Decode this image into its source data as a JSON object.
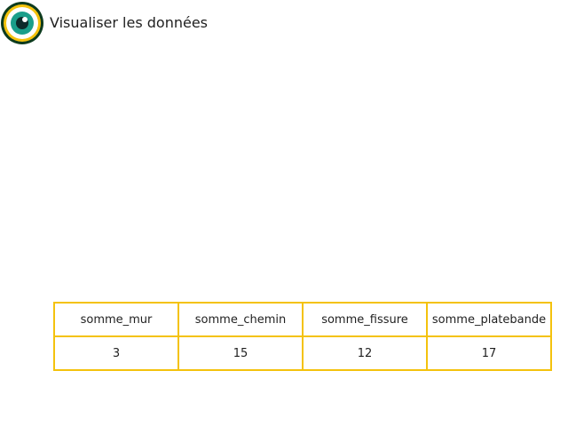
{
  "header": {
    "title": "Visualiser les données",
    "logo_icon": "eye-icon",
    "colors": {
      "logo_outer_ring": "#0d3b1e",
      "logo_yellow_ring": "#f4c20d",
      "logo_iris": "#1a9e8a",
      "logo_pupil": "#0d2a2a",
      "table_border": "#f4c20d"
    }
  },
  "table": {
    "columns": [
      "somme_mur",
      "somme_chemin",
      "somme_fissure",
      "somme_platebande"
    ],
    "rows": [
      [
        "3",
        "15",
        "12",
        "17"
      ]
    ]
  }
}
